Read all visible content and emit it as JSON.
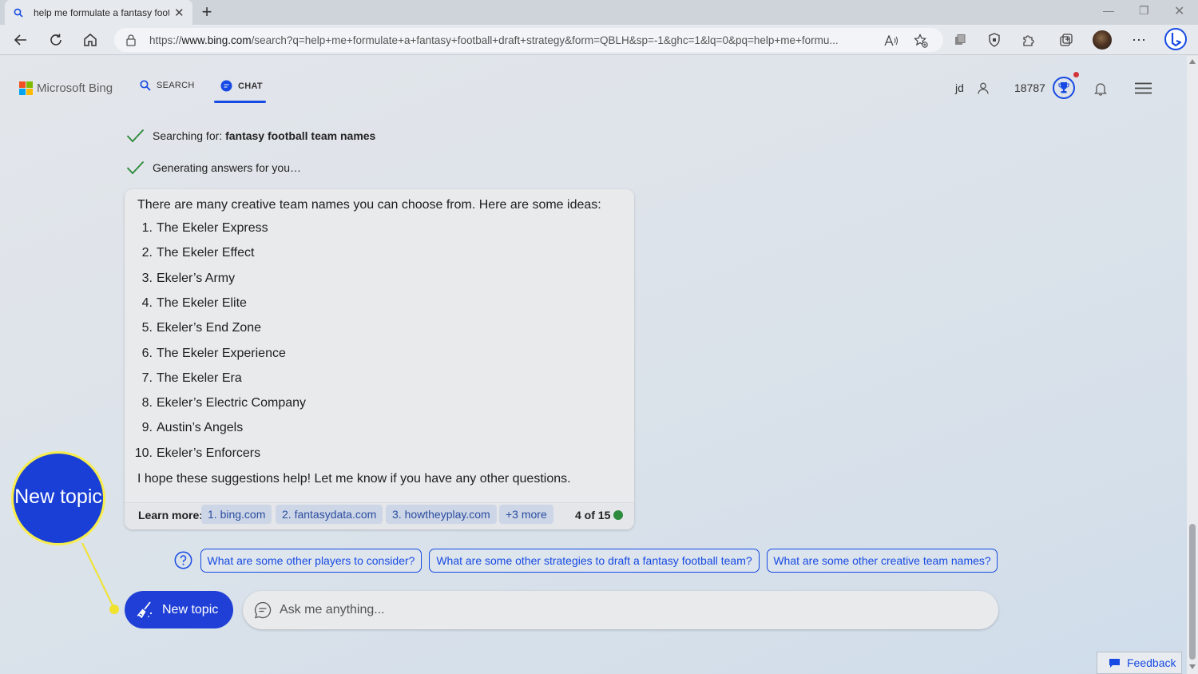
{
  "browser": {
    "tab_title": "help me formulate a fantasy football draft strategy",
    "address_prefix": "https://",
    "address_domain": "www.bing.com",
    "address_path": "/search?q=help+me+formulate+a+fantasy+football+draft+strategy&form=QBLH&sp=-1&ghc=1&lq=0&pq=help+me+formu...",
    "read_aloud_icon": "A͈"
  },
  "header": {
    "logo_text": "Microsoft Bing",
    "nav": {
      "search": "SEARCH",
      "chat": "CHAT"
    },
    "user_initials": "jd",
    "points": "18787"
  },
  "status": {
    "searching_prefix": "Searching for: ",
    "searching_query": "fantasy football team names",
    "generating": "Generating answers for you…"
  },
  "answer": {
    "intro": "There are many creative team names you can choose from. Here are some ideas:",
    "items": [
      {
        "num": "1.",
        "text": "The Ekeler Express"
      },
      {
        "num": "2.",
        "text": "The Ekeler Effect"
      },
      {
        "num": "3.",
        "text": "Ekeler’s Army"
      },
      {
        "num": "4.",
        "text": "The Ekeler Elite"
      },
      {
        "num": "5.",
        "text": "Ekeler’s End Zone"
      },
      {
        "num": "6.",
        "text": "The Ekeler Experience"
      },
      {
        "num": "7.",
        "text": "The Ekeler Era"
      },
      {
        "num": "8.",
        "text": "Ekeler’s Electric Company"
      },
      {
        "num": "9.",
        "text": "Austin’s Angels"
      },
      {
        "num": "10.",
        "text": "Ekeler’s Enforcers"
      }
    ],
    "outro": "I hope these suggestions help! Let me know if you have any other questions.",
    "learn_more_label": "Learn more:",
    "sources": [
      "1. bing.com",
      "2. fantasydata.com",
      "3. howtheyplay.com",
      "+3 more"
    ],
    "turn_count": "4 of 15"
  },
  "suggestions": [
    "What are some other players to consider?",
    "What are some other strategies to draft a fantasy football team?",
    "What are some other creative team names?"
  ],
  "composer": {
    "new_topic": "New topic",
    "placeholder": "Ask me anything..."
  },
  "feedback_label": "Feedback",
  "callout_label": "New topic",
  "colors": {
    "accent": "#174ae4",
    "new_topic_bg": "#1f3fd6",
    "callout_border": "#f7ed4d",
    "status_check": "#2e8b3d"
  }
}
